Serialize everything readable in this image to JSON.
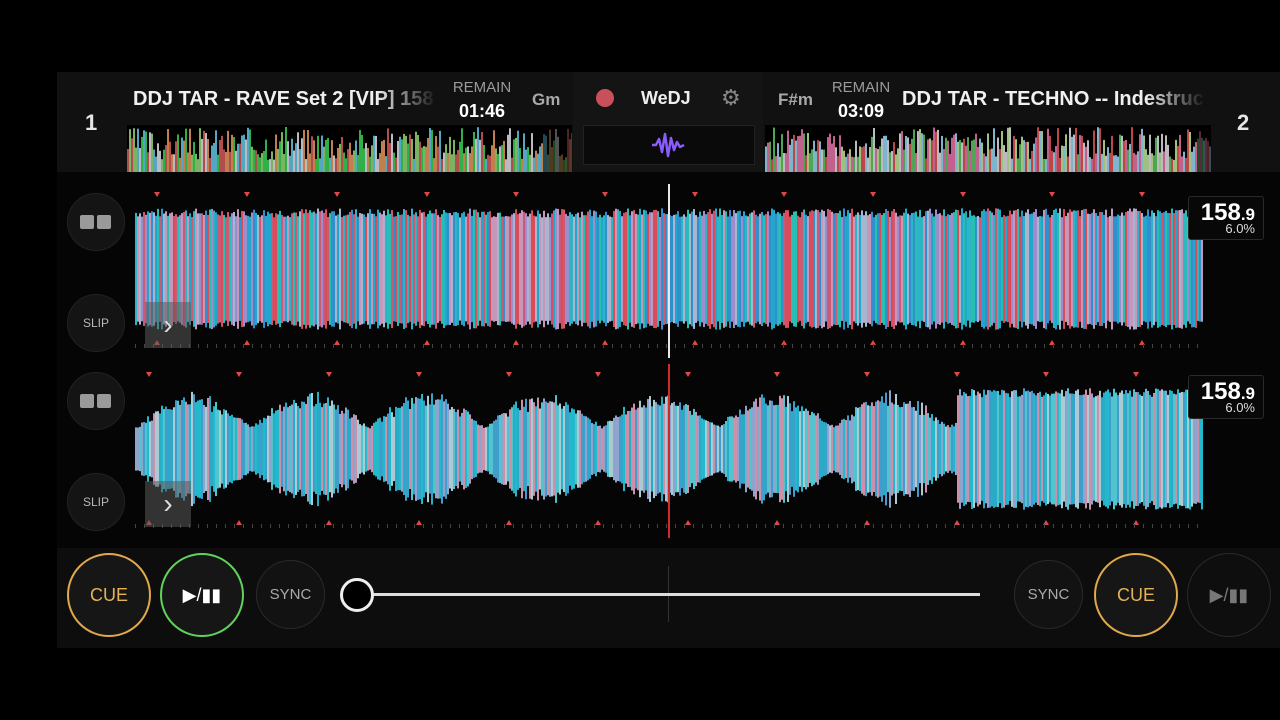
{
  "deck1": {
    "number": "1",
    "title": "DDJ TAR - RAVE Set 2 [VIP] 158",
    "remain_label": "REMAIN",
    "remain_time": "01:46",
    "key": "Gm",
    "bpm_main": "158",
    "bpm_decimal": ".9",
    "pitch": "6.0%",
    "slip_label": "SLIP",
    "cue_label": "CUE",
    "play_label": "▶/▮▮",
    "sync_label": "SYNC"
  },
  "deck2": {
    "number": "2",
    "title": "DDJ TAR - TECHNO -- Indestructible",
    "remain_label": "REMAIN",
    "remain_time": "03:09",
    "key": "F#m",
    "bpm_main": "158",
    "bpm_decimal": ".9",
    "pitch": "6.0%",
    "slip_label": "SLIP",
    "cue_label": "CUE",
    "play_label": "▶/▮▮",
    "sync_label": "SYNC"
  },
  "center": {
    "brand": "WeDJ",
    "record_icon": "record-icon",
    "settings_icon": "gear-icon",
    "waveform_icon": "waveform-icon"
  },
  "crossfader": {
    "position": 0.0
  },
  "colors": {
    "cue": "#e0a94a",
    "play_active": "#5fd35a",
    "record": "#c9505a",
    "waveform_accent": "#8a5cff"
  }
}
